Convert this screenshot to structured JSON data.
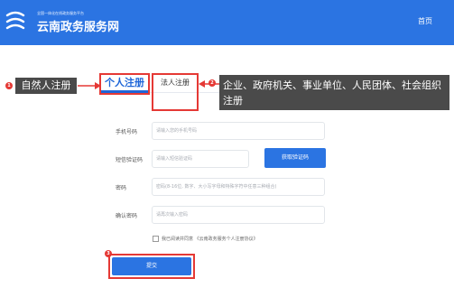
{
  "header": {
    "tagline": "全国一体化在线政务服务平台",
    "title": "云南政务服务网",
    "home_label": "首页"
  },
  "tabs": [
    {
      "label": "个人注册",
      "active": true
    },
    {
      "label": "法人注册",
      "active": false
    }
  ],
  "annotations": {
    "marker1": "1",
    "note1": "自然人注册",
    "marker2": "2",
    "note2": "企业、政府机关、事业单位、人民团体、社会组织注册",
    "marker3": "3"
  },
  "form": {
    "phone": {
      "label": "手机号码",
      "placeholder": "请输入您的手机号码"
    },
    "sms": {
      "label": "短信验证码",
      "placeholder": "请输入短信验证码",
      "button": "获取验证码"
    },
    "password": {
      "label": "密码",
      "placeholder": "密码(8-16位, 数字、大小写字母和特殊字符中任意三种组合)"
    },
    "confirm": {
      "label": "确认密码",
      "placeholder": "请再次输入密码"
    },
    "agreement": "我已阅读并同意 《云南政务服务个人注册协议》",
    "submit": "提交"
  },
  "colors": {
    "primary": "#2b74e2",
    "highlight": "#e53935",
    "annotation_bg": "#4a4a4a"
  }
}
